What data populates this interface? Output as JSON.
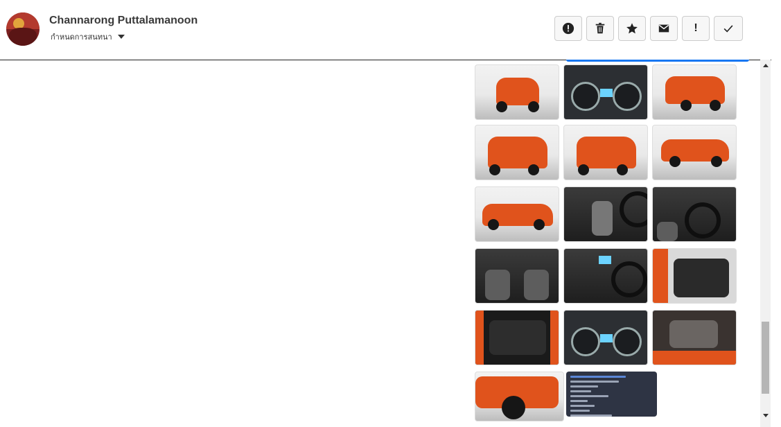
{
  "header": {
    "user_name": "Channarong Puttalamanoon",
    "subtitle": "กำหนดการสนทนา",
    "avatar_icon": "avatar-photo"
  },
  "actions": [
    {
      "name": "report-button",
      "icon": "alert-circle-icon"
    },
    {
      "name": "delete-button",
      "icon": "trash-icon"
    },
    {
      "name": "favorite-button",
      "icon": "star-icon"
    },
    {
      "name": "email-button",
      "icon": "mail-icon"
    },
    {
      "name": "important-button",
      "icon": "exclamation-icon",
      "label": "!"
    },
    {
      "name": "done-button",
      "icon": "check-icon"
    }
  ],
  "gallery": {
    "images": [
      "car-front",
      "instrument-cluster",
      "car-front-angle",
      "car-rear",
      "car-rear",
      "car-side",
      "car-side-left",
      "gear-shifter",
      "dashboard-interior",
      "front-seats",
      "steering-console",
      "door-panel",
      "trunk-cargo",
      "instrument-cluster",
      "engine-bay",
      "car-wheel-closeup",
      "spec-document"
    ]
  },
  "colors": {
    "accent": "#1877f2",
    "car_orange": "#e0531c",
    "doc_bg": "#2e3444"
  }
}
